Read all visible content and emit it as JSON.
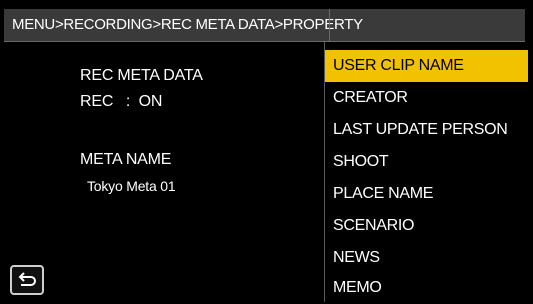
{
  "header": {
    "breadcrumb": "MENU>RECORDING>REC META DATA>PROPERTY"
  },
  "info": {
    "rec_meta_data_label": "REC META DATA",
    "rec_status": "REC   :  ON",
    "meta_name_label": "META NAME",
    "meta_name_value": "Tokyo Meta 01"
  },
  "menu": {
    "items": [
      {
        "label": "USER CLIP NAME",
        "selected": true
      },
      {
        "label": "CREATOR",
        "selected": false
      },
      {
        "label": "LAST UPDATE PERSON",
        "selected": false
      },
      {
        "label": "SHOOT",
        "selected": false
      },
      {
        "label": "PLACE NAME",
        "selected": false
      },
      {
        "label": "SCENARIO",
        "selected": false
      },
      {
        "label": "NEWS",
        "selected": false
      },
      {
        "label": "MEMO",
        "selected": false
      }
    ]
  },
  "back_button": {
    "icon": "return-arrow-icon"
  },
  "colors": {
    "background": "#000000",
    "header_bg": "#3a3a3a",
    "highlight": "#f2c100",
    "text": "#ffffff"
  }
}
